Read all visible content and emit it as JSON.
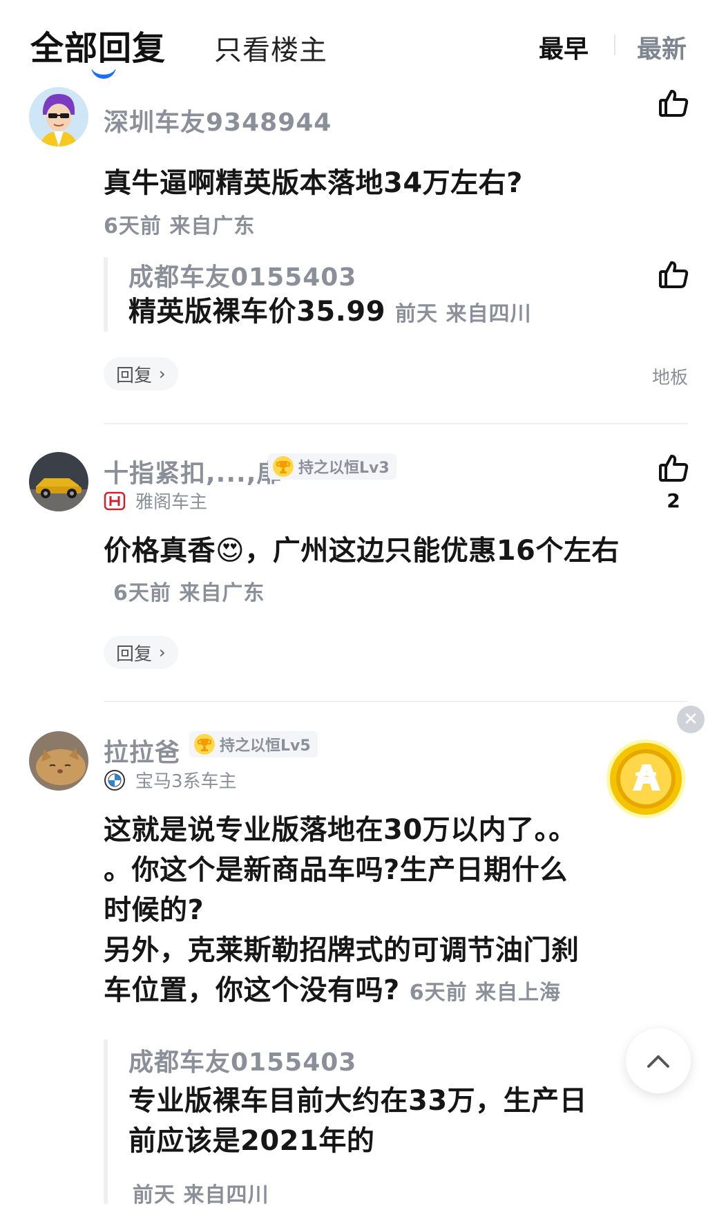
{
  "tabs": {
    "all_replies": "全部回复",
    "owner_only": "只看楼主",
    "sort_earliest": "最早",
    "sort_latest": "最新"
  },
  "comments": [
    {
      "username": "深圳车友9348944",
      "content": "真牛逼啊精英版本落地34万左右?",
      "meta": "6天前 来自广东",
      "like_count": "",
      "quote": {
        "username": "成都车友0155403",
        "text": "精英版裸车价35.99",
        "meta": "前天 来自四川"
      },
      "reply_label": "回复",
      "floor_label": "地板"
    },
    {
      "username": "十指紧扣,...,扉",
      "badge": "持之以恒Lv3",
      "car_owner": "雅阁车主",
      "content": "价格真香😍，广州这边只能优惠16个左右",
      "meta": "6天前 来自广东",
      "like_count": "2",
      "reply_label": "回复"
    },
    {
      "username": "拉拉爸",
      "badge": "持之以恒Lv5",
      "car_owner": "宝马3系车主",
      "content_lines": [
        "这就是说专业版落地在30万以内了。。",
        "。你这个是新商品车吗?生产日期什么",
        "时候的?",
        "另外，克莱斯勒招牌式的可调节油门刹",
        "车位置，你这个没有吗?"
      ],
      "meta": "6天前 来自上海",
      "quote": {
        "username": "成都车友0155403",
        "text_lines": [
          "专业版裸车目前大约在33万，生产日",
          "前应该是2021年的"
        ],
        "meta": "前天 来自四川"
      }
    }
  ],
  "icons": {
    "like": "thumbs-up-icon",
    "close": "close-icon",
    "coin": "coin-icon",
    "scroll_top": "chevron-up-icon"
  },
  "colors": {
    "accent": "#1e6bff",
    "secondary_text": "#8a8f99",
    "coin": "#f5b800"
  }
}
